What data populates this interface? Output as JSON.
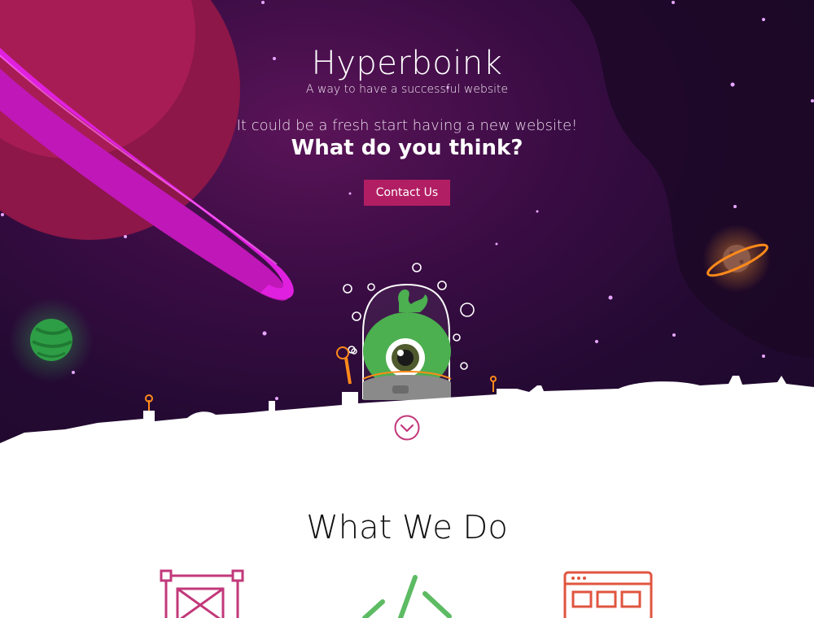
{
  "hero": {
    "title": "Hyperboink",
    "subtitle": "A way to have a successful website",
    "tagline": "It could be a fresh start having a new website!",
    "headline": "What do you think?",
    "contact_label": "Contact Us"
  },
  "colors": {
    "accent": "#b21e63",
    "background_dark": "#240a33",
    "planet": "#a11a4f",
    "ring": "#d21ed6",
    "alien": "#4caf50"
  },
  "icons": {
    "scroll": "chevron-down-circle-icon",
    "services": [
      "design-frame-icon",
      "code-icon",
      "web-layout-icon"
    ]
  },
  "what_we_do": {
    "title": "What We Do"
  }
}
